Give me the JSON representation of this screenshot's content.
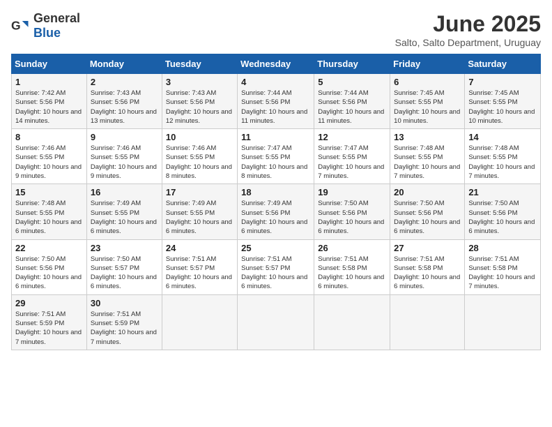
{
  "logo": {
    "text_general": "General",
    "text_blue": "Blue"
  },
  "title": "June 2025",
  "subtitle": "Salto, Salto Department, Uruguay",
  "days_of_week": [
    "Sunday",
    "Monday",
    "Tuesday",
    "Wednesday",
    "Thursday",
    "Friday",
    "Saturday"
  ],
  "weeks": [
    [
      {
        "day": "1",
        "sunrise": "Sunrise: 7:42 AM",
        "sunset": "Sunset: 5:56 PM",
        "daylight": "Daylight: 10 hours and 14 minutes."
      },
      {
        "day": "2",
        "sunrise": "Sunrise: 7:43 AM",
        "sunset": "Sunset: 5:56 PM",
        "daylight": "Daylight: 10 hours and 13 minutes."
      },
      {
        "day": "3",
        "sunrise": "Sunrise: 7:43 AM",
        "sunset": "Sunset: 5:56 PM",
        "daylight": "Daylight: 10 hours and 12 minutes."
      },
      {
        "day": "4",
        "sunrise": "Sunrise: 7:44 AM",
        "sunset": "Sunset: 5:56 PM",
        "daylight": "Daylight: 10 hours and 11 minutes."
      },
      {
        "day": "5",
        "sunrise": "Sunrise: 7:44 AM",
        "sunset": "Sunset: 5:56 PM",
        "daylight": "Daylight: 10 hours and 11 minutes."
      },
      {
        "day": "6",
        "sunrise": "Sunrise: 7:45 AM",
        "sunset": "Sunset: 5:55 PM",
        "daylight": "Daylight: 10 hours and 10 minutes."
      },
      {
        "day": "7",
        "sunrise": "Sunrise: 7:45 AM",
        "sunset": "Sunset: 5:55 PM",
        "daylight": "Daylight: 10 hours and 10 minutes."
      }
    ],
    [
      {
        "day": "8",
        "sunrise": "Sunrise: 7:46 AM",
        "sunset": "Sunset: 5:55 PM",
        "daylight": "Daylight: 10 hours and 9 minutes."
      },
      {
        "day": "9",
        "sunrise": "Sunrise: 7:46 AM",
        "sunset": "Sunset: 5:55 PM",
        "daylight": "Daylight: 10 hours and 9 minutes."
      },
      {
        "day": "10",
        "sunrise": "Sunrise: 7:46 AM",
        "sunset": "Sunset: 5:55 PM",
        "daylight": "Daylight: 10 hours and 8 minutes."
      },
      {
        "day": "11",
        "sunrise": "Sunrise: 7:47 AM",
        "sunset": "Sunset: 5:55 PM",
        "daylight": "Daylight: 10 hours and 8 minutes."
      },
      {
        "day": "12",
        "sunrise": "Sunrise: 7:47 AM",
        "sunset": "Sunset: 5:55 PM",
        "daylight": "Daylight: 10 hours and 7 minutes."
      },
      {
        "day": "13",
        "sunrise": "Sunrise: 7:48 AM",
        "sunset": "Sunset: 5:55 PM",
        "daylight": "Daylight: 10 hours and 7 minutes."
      },
      {
        "day": "14",
        "sunrise": "Sunrise: 7:48 AM",
        "sunset": "Sunset: 5:55 PM",
        "daylight": "Daylight: 10 hours and 7 minutes."
      }
    ],
    [
      {
        "day": "15",
        "sunrise": "Sunrise: 7:48 AM",
        "sunset": "Sunset: 5:55 PM",
        "daylight": "Daylight: 10 hours and 6 minutes."
      },
      {
        "day": "16",
        "sunrise": "Sunrise: 7:49 AM",
        "sunset": "Sunset: 5:55 PM",
        "daylight": "Daylight: 10 hours and 6 minutes."
      },
      {
        "day": "17",
        "sunrise": "Sunrise: 7:49 AM",
        "sunset": "Sunset: 5:55 PM",
        "daylight": "Daylight: 10 hours and 6 minutes."
      },
      {
        "day": "18",
        "sunrise": "Sunrise: 7:49 AM",
        "sunset": "Sunset: 5:56 PM",
        "daylight": "Daylight: 10 hours and 6 minutes."
      },
      {
        "day": "19",
        "sunrise": "Sunrise: 7:50 AM",
        "sunset": "Sunset: 5:56 PM",
        "daylight": "Daylight: 10 hours and 6 minutes."
      },
      {
        "day": "20",
        "sunrise": "Sunrise: 7:50 AM",
        "sunset": "Sunset: 5:56 PM",
        "daylight": "Daylight: 10 hours and 6 minutes."
      },
      {
        "day": "21",
        "sunrise": "Sunrise: 7:50 AM",
        "sunset": "Sunset: 5:56 PM",
        "daylight": "Daylight: 10 hours and 6 minutes."
      }
    ],
    [
      {
        "day": "22",
        "sunrise": "Sunrise: 7:50 AM",
        "sunset": "Sunset: 5:56 PM",
        "daylight": "Daylight: 10 hours and 6 minutes."
      },
      {
        "day": "23",
        "sunrise": "Sunrise: 7:50 AM",
        "sunset": "Sunset: 5:57 PM",
        "daylight": "Daylight: 10 hours and 6 minutes."
      },
      {
        "day": "24",
        "sunrise": "Sunrise: 7:51 AM",
        "sunset": "Sunset: 5:57 PM",
        "daylight": "Daylight: 10 hours and 6 minutes."
      },
      {
        "day": "25",
        "sunrise": "Sunrise: 7:51 AM",
        "sunset": "Sunset: 5:57 PM",
        "daylight": "Daylight: 10 hours and 6 minutes."
      },
      {
        "day": "26",
        "sunrise": "Sunrise: 7:51 AM",
        "sunset": "Sunset: 5:58 PM",
        "daylight": "Daylight: 10 hours and 6 minutes."
      },
      {
        "day": "27",
        "sunrise": "Sunrise: 7:51 AM",
        "sunset": "Sunset: 5:58 PM",
        "daylight": "Daylight: 10 hours and 6 minutes."
      },
      {
        "day": "28",
        "sunrise": "Sunrise: 7:51 AM",
        "sunset": "Sunset: 5:58 PM",
        "daylight": "Daylight: 10 hours and 7 minutes."
      }
    ],
    [
      {
        "day": "29",
        "sunrise": "Sunrise: 7:51 AM",
        "sunset": "Sunset: 5:59 PM",
        "daylight": "Daylight: 10 hours and 7 minutes."
      },
      {
        "day": "30",
        "sunrise": "Sunrise: 7:51 AM",
        "sunset": "Sunset: 5:59 PM",
        "daylight": "Daylight: 10 hours and 7 minutes."
      },
      null,
      null,
      null,
      null,
      null
    ]
  ]
}
